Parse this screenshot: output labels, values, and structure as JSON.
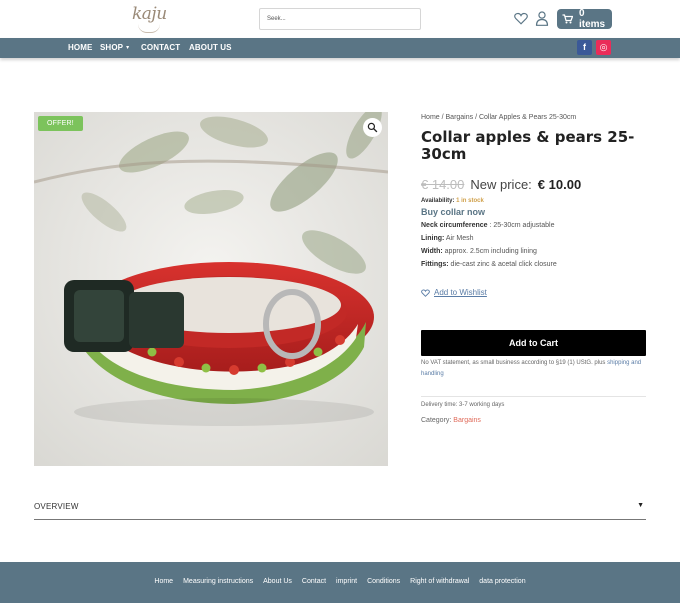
{
  "header": {
    "logo_text": "kaju",
    "search_placeholder": "Seek...",
    "cart_label": "0 items"
  },
  "nav": {
    "items": [
      "HOME",
      "SHOP",
      "CONTACT",
      "ABOUT US"
    ],
    "shop_caret": "▾",
    "social": {
      "facebook": "f",
      "instagram": "◎"
    }
  },
  "product": {
    "badge": "OFFER!",
    "breadcrumb": "Home / Bargains / Collar Apples & Pears 25-30cm",
    "title": "Collar apples & pears 25-30cm",
    "old_price": "€ 14.00",
    "new_price_label": "New price:",
    "new_price": "€ 10.00",
    "availability_label": "Availability:",
    "availability_value": "1 in stock",
    "buy_heading": "Buy collar now",
    "specs": [
      {
        "label": "Neck circumference",
        "value": " : 25-30cm adjustable"
      },
      {
        "label": "Lining:",
        "value": " Air Mesh"
      },
      {
        "label": "Width:",
        "value": " approx. 2.5cm including lining"
      },
      {
        "label": "Fittings:",
        "value": " die-cast zinc & acetal click closure"
      }
    ],
    "wishlist": "Add to Wishlist",
    "add_to_cart": "Add to Cart",
    "vat_text": "No VAT statement, as small business according to §19 (1) UStG. plus ",
    "vat_link": "shipping and handling",
    "delivery": "Delivery time: 3-7 working days",
    "category_label": "Category: ",
    "category_value": "Bargains"
  },
  "overview": {
    "label": "OVERVIEW",
    "toggle": "▼"
  },
  "footer": {
    "links": [
      "Home",
      "Measuring instructions",
      "About Us",
      "Contact",
      "imprint",
      "Conditions",
      "Right of withdrawal",
      "data protection"
    ]
  },
  "colors": {
    "brand": "#5a7585",
    "offer": "#7cc35c",
    "stock": "#d0a04a",
    "link": "#5a7ca6",
    "category": "#e06b5a"
  }
}
